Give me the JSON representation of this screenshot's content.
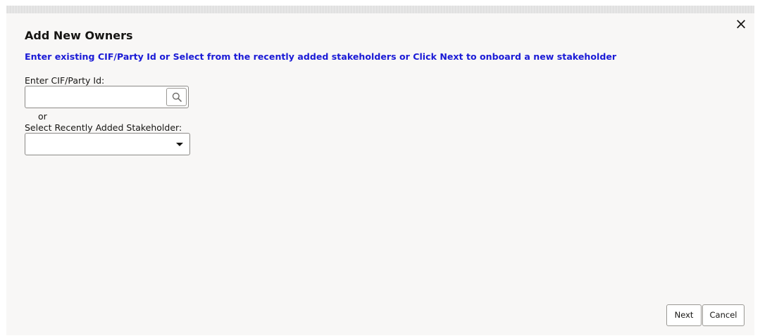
{
  "dialog": {
    "title": "Add New Owners",
    "subtitle": "Enter existing CIF/Party Id or Select from the recently added stakeholders or Click Next to onboard a new stakeholder",
    "close_symbol": "×",
    "colors": {
      "subtitle": "#1a1ad6",
      "background": "#f8f7f6"
    }
  },
  "cif": {
    "label": "Enter CIF/Party Id:",
    "value": "",
    "search_icon": "search-icon"
  },
  "or_text": "or",
  "recent": {
    "label": "Select Recently Added Stakeholder:",
    "selected": "",
    "arrow_icon": "caret-down-icon"
  },
  "footer": {
    "next_label": "Next",
    "cancel_label": "Cancel"
  }
}
